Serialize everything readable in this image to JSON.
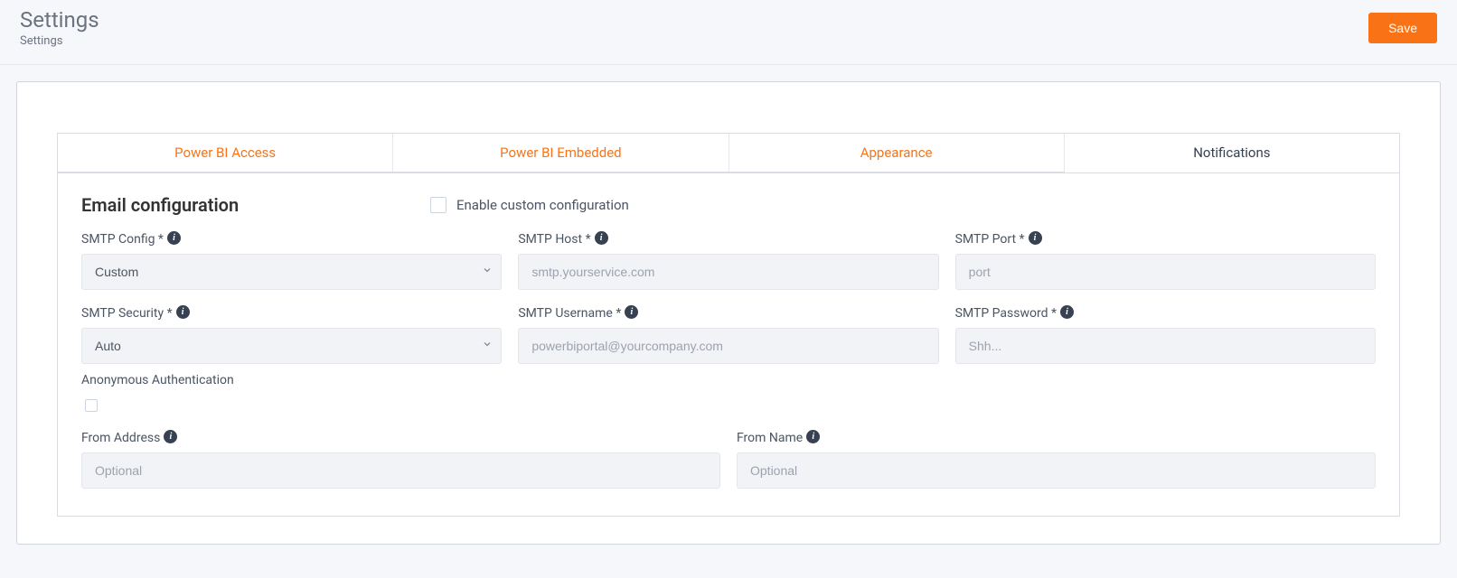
{
  "header": {
    "title": "Settings",
    "subtitle": "Settings",
    "save_label": "Save"
  },
  "tabs": [
    {
      "label": "Power BI Access",
      "active": false
    },
    {
      "label": "Power BI Embedded",
      "active": false
    },
    {
      "label": "Appearance",
      "active": false
    },
    {
      "label": "Notifications",
      "active": true
    }
  ],
  "section": {
    "title": "Email configuration",
    "enable_label": "Enable custom configuration",
    "enable_checked": false
  },
  "fields": {
    "smtp_config": {
      "label": "SMTP Config *",
      "value": "Custom"
    },
    "smtp_host": {
      "label": "SMTP Host *",
      "placeholder": "smtp.yourservice.com",
      "value": ""
    },
    "smtp_port": {
      "label": "SMTP Port *",
      "placeholder": "port",
      "value": ""
    },
    "smtp_security": {
      "label": "SMTP Security *",
      "value": "Auto"
    },
    "smtp_username": {
      "label": "SMTP Username *",
      "placeholder": "powerbiportal@yourcompany.com",
      "value": ""
    },
    "smtp_password": {
      "label": "SMTP Password *",
      "placeholder": "Shh...",
      "value": ""
    },
    "anon_auth": {
      "label": "Anonymous Authentication",
      "checked": false
    },
    "from_address": {
      "label": "From Address",
      "placeholder": "Optional",
      "value": ""
    },
    "from_name": {
      "label": "From Name",
      "placeholder": "Optional",
      "value": ""
    }
  }
}
